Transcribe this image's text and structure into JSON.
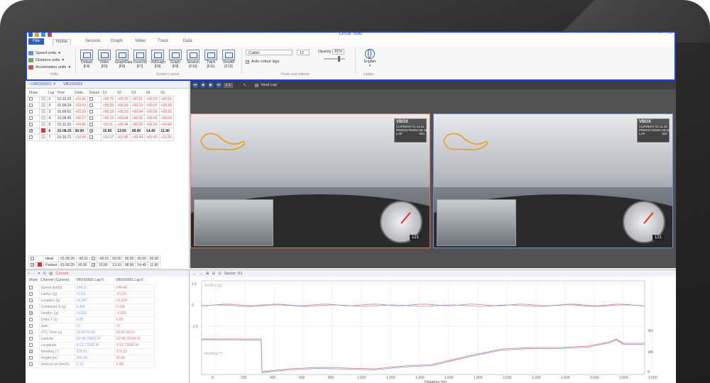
{
  "window": {
    "title": "Circuit Tools"
  },
  "ribbon": {
    "tabs": [
      "File",
      "Home",
      "Session",
      "Graph",
      "Video",
      "Track",
      "Data"
    ],
    "units": [
      "Speed units",
      "Distance units",
      "Acceleration units"
    ],
    "units_group": "Units",
    "layouts": [
      {
        "label": "Default",
        "key": "[F4]"
      },
      {
        "label": "Video",
        "key": "[F5]"
      },
      {
        "label": "GraphData",
        "key": "[F6]"
      },
      {
        "label": "TrackVid",
        "key": "[F7]"
      },
      {
        "label": "VidGraph",
        "key": "[F8]"
      },
      {
        "label": "Graph",
        "key": "[F9]"
      },
      {
        "label": "Session",
        "key": "[F10]"
      },
      {
        "label": "Track",
        "key": "[F11]"
      },
      {
        "label": "ViewAll",
        "key": "[F12]"
      }
    ],
    "layout_group": "Screen Layout",
    "font": "Calibri",
    "font_size": "12",
    "opacity_label": "Opacity",
    "opacity": "81%",
    "auto_colour": "Auto colour laps",
    "fonts_group": "Fonts and colours",
    "language": "English",
    "lang_group": "Langu..."
  },
  "docs": {
    "tabs": [
      "VBOX0001",
      "VBOX0002"
    ]
  },
  "laps": {
    "headers": [
      "Show",
      "",
      "Lap",
      "Time",
      "Delta",
      "Datum",
      "S1",
      "S2",
      "S3",
      "S4",
      "S5"
    ],
    "rows": [
      {
        "lap": "1",
        "time": "01:10.22",
        "delta": "+03.96",
        "s": [
          "+00.75",
          "+00.29",
          "+00.21",
          "+00.10",
          "+00.51"
        ]
      },
      {
        "lap": "2",
        "time": "01:09.24",
        "delta": "+03.03",
        "s": [
          "+00.29",
          "+00.29",
          "+00.13",
          "+00.07",
          "+00.28"
        ]
      },
      {
        "lap": "3",
        "time": "01:09.61",
        "delta": "+03.39",
        "s": [
          "+00.18",
          "+00.23",
          "+00.04",
          "+00.36",
          "+00.56"
        ]
      },
      {
        "lap": "4",
        "time": "01:08.45",
        "delta": "+00.27",
        "s": [
          "+00.15",
          "+00.04",
          "+00.05",
          "+00.05",
          "+00.04"
        ]
      },
      {
        "lap": "5",
        "time": "01:11.33",
        "delta": "+04.86",
        "s": [
          "-00.01",
          "+00.44",
          "+00.26",
          "+02.16",
          "+00.84"
        ]
      },
      {
        "lap": "6",
        "time": "01:08.25",
        "delta": "00.00",
        "s": [
          "15.90",
          "13.50",
          "08.90",
          "14.40",
          "11.90"
        ],
        "bold": true
      },
      {
        "lap": "7",
        "time": "01:16.71",
        "delta": "+10.49",
        "s": [
          "+02.07",
          "+01.85",
          "+00.44",
          "+01.43",
          "+12.25"
        ]
      }
    ],
    "summary": [
      {
        "label": "Ideal",
        "time": "01:08.20",
        "delta": "-00.01",
        "s": [
          "-00.01",
          "00.00",
          "00.00",
          "00.00",
          "00.00"
        ]
      },
      {
        "label": "Fastest",
        "time": "01:08.25",
        "delta": "00.00",
        "s": [
          "10.90",
          "13.10",
          "08.90",
          "14.40",
          "11.90"
        ]
      }
    ]
  },
  "video": {
    "speed": "x 1",
    "ideal_label": "Ideal Lap",
    "left": {
      "brand": "VBOX",
      "rows": [
        [
          "CURRENT",
          "01:13.61"
        ],
        [
          "PREDICTED",
          "01:08.49"
        ],
        [
          "LAP",
          "004"
        ]
      ],
      "gauge": "121"
    },
    "right": {
      "brand": "VBOX",
      "rows": [
        [
          "CURRENT",
          "01:11.30"
        ],
        [
          "PREDICTED",
          "01:08.52"
        ],
        [
          "LAP",
          "007"
        ]
      ],
      "gauge": "121"
    }
  },
  "channels": {
    "toolbar_current": "Current",
    "headers": [
      "Show",
      "Channel (Current)",
      "VBOX0002 Lap 6",
      "VBOX0001 Lap 6"
    ],
    "rows": [
      {
        "name": "Speed (km/h)",
        "v1": "144.11",
        "v2": "144.40",
        "checked": false
      },
      {
        "name": "LatAcc (g)",
        "v1": "-0.111",
        "v2": "-0.129",
        "checked": false
      },
      {
        "name": "LongAcc (g)",
        "v1": "+0.347",
        "v2": "+0.314",
        "checked": false
      },
      {
        "name": "Combined G (g)",
        "v1": "0.466",
        "v2": "0.336",
        "checked": false
      },
      {
        "name": "VertAcc (g)",
        "v1": "-0.020",
        "v2": "-0.020",
        "checked": true
      },
      {
        "name": "Delta-T (s)",
        "v1": "0.00",
        "v2": "0.00",
        "checked": false
      },
      {
        "name": "Sats",
        "v1": "12",
        "v2": "12",
        "checked": false
      },
      {
        "name": "UTC Time (s)",
        "v1": "15:00:05.90",
        "v2": "15:00:20.10",
        "checked": false
      },
      {
        "name": "Latitude",
        "v1": "52°49.79602 N",
        "v2": "52°49.79164 N",
        "checked": false
      },
      {
        "name": "Longitude",
        "v1": "1°22.77930 W",
        "v2": "1°22.77930 W",
        "checked": false
      },
      {
        "name": "Heading (°)",
        "v1": "276.51",
        "v2": "279.32",
        "checked": true
      },
      {
        "name": "Height (m)",
        "v1": "100.24",
        "v2": "99.02",
        "checked": false
      },
      {
        "name": "Vertical vel (km/h)",
        "v1": "2.12",
        "v2": "2.48",
        "checked": false
      }
    ]
  },
  "graph": {
    "sector": "Sector: S1",
    "top_label": "VertAcc (g)",
    "bottom_label": "Heading (°)",
    "xlabel": "Distance (m)",
    "left_ticks": [
      "1.5",
      "0",
      "-1.5"
    ],
    "right_ticks": [
      "360",
      "180",
      "0"
    ],
    "x_ticks": [
      "0",
      "200",
      "400",
      "600",
      "800",
      "1,000",
      "1,200",
      "1,400",
      "1,600",
      "1,800",
      "2,000",
      "2,200",
      "2,400",
      "2,600",
      "2,800",
      "3,000"
    ]
  }
}
